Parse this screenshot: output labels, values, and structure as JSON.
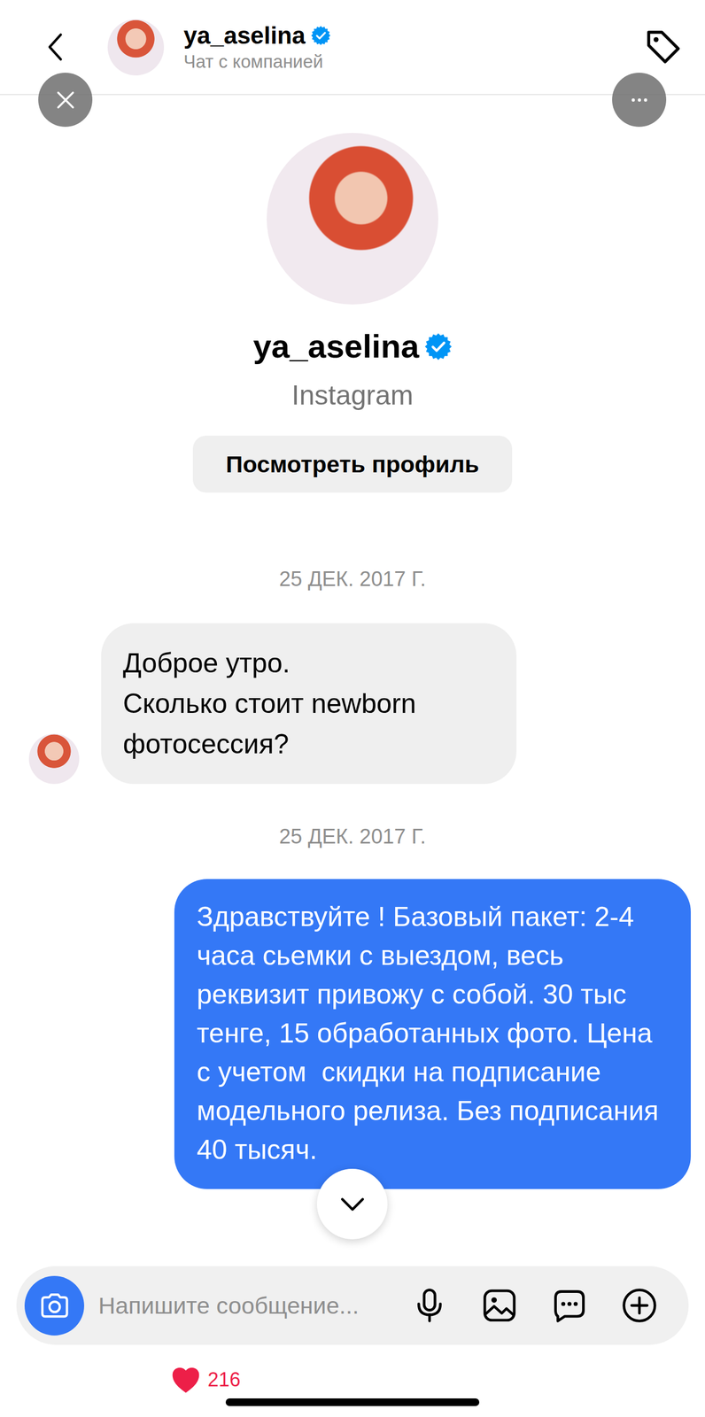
{
  "header": {
    "username": "ya_aselina",
    "verified": true,
    "subtitle": "Чат с компанией"
  },
  "profile": {
    "username": "ya_aselina",
    "verified": true,
    "platform": "Instagram",
    "button": "Посмотреть профиль"
  },
  "messages": [
    {
      "date": "25 ДЕК. 2017 Г.",
      "kind": "incoming",
      "text": "Доброе утро.\nСколько стоит newborn фотосессия?"
    },
    {
      "date": "25 ДЕК. 2017 Г.",
      "kind": "outgoing",
      "text": "Здравствуйте ! Базовый пакет: 2-4 часа сьемки с выездом, весь реквизит привожу с собой. 30 тыс тенге, 15 обработанных фото. Цена с учетом  скидки на подписание модельного релиза. Без подписания 40 тысяч."
    }
  ],
  "composer": {
    "placeholder": "Напишите сообщение..."
  },
  "likes": {
    "count": "216",
    "liked": true
  }
}
